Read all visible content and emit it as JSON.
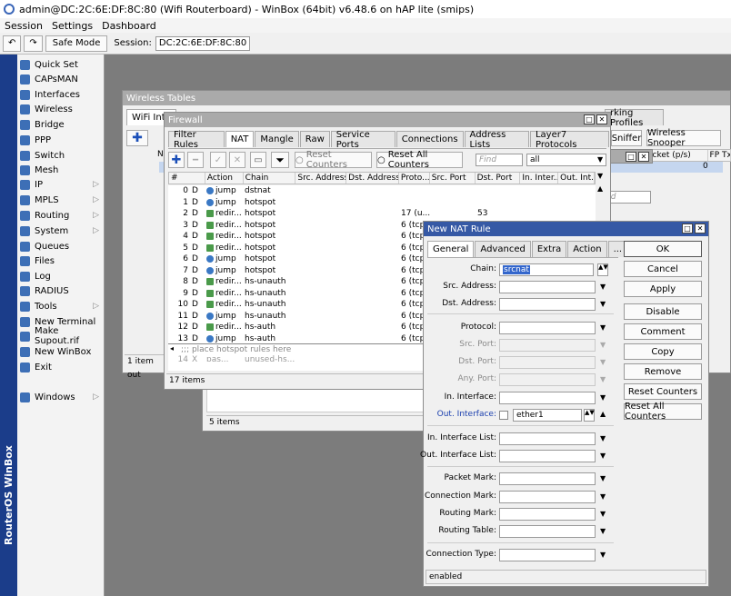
{
  "window_title": "admin@DC:2C:6E:DF:8C:80 (Wifi Routerboard) - WinBox (64bit) v6.48.6 on hAP lite (smips)",
  "menu": [
    "Session",
    "Settings",
    "Dashboard"
  ],
  "toolbar": {
    "safe_mode": "Safe Mode",
    "session_label": "Session:",
    "session_value": "DC:2C:6E:DF:8C:80",
    "undo": "↶",
    "redo": "↷"
  },
  "sidebar_vertical": "RouterOS WinBox",
  "sidebar": [
    {
      "label": "Quick Set",
      "arrow": ""
    },
    {
      "label": "CAPsMAN",
      "arrow": ""
    },
    {
      "label": "Interfaces",
      "arrow": ""
    },
    {
      "label": "Wireless",
      "arrow": ""
    },
    {
      "label": "Bridge",
      "arrow": ""
    },
    {
      "label": "PPP",
      "arrow": ""
    },
    {
      "label": "Switch",
      "arrow": ""
    },
    {
      "label": "Mesh",
      "arrow": ""
    },
    {
      "label": "IP",
      "arrow": "▷"
    },
    {
      "label": "MPLS",
      "arrow": "▷"
    },
    {
      "label": "Routing",
      "arrow": "▷"
    },
    {
      "label": "System",
      "arrow": "▷"
    },
    {
      "label": "Queues",
      "arrow": ""
    },
    {
      "label": "Files",
      "arrow": ""
    },
    {
      "label": "Log",
      "arrow": ""
    },
    {
      "label": "RADIUS",
      "arrow": ""
    },
    {
      "label": "Tools",
      "arrow": "▷"
    },
    {
      "label": "New Terminal",
      "arrow": ""
    },
    {
      "label": "Make Supout.rif",
      "arrow": ""
    },
    {
      "label": "New WinBox",
      "arrow": ""
    },
    {
      "label": "Exit",
      "arrow": ""
    },
    {
      "label": "Windows",
      "arrow": "▷"
    }
  ],
  "wireless": {
    "title": "Wireless Tables",
    "tab_wifi": "WiFi Inte",
    "tab_profiles": "rking Profiles",
    "btn_sniffer": "Sniffer",
    "btn_snooper": "Wireless Snooper",
    "col_packet": "acket (p/s)",
    "col_fp": "FP Tx",
    "val_zero": "0",
    "col_n": "N",
    "find_placeholder": "nd",
    "status": "1 item out"
  },
  "bg_window": {
    "status": "5 items"
  },
  "firewall": {
    "title": "Firewall",
    "tabs": [
      "Filter Rules",
      "NAT",
      "Mangle",
      "Raw",
      "Service Ports",
      "Connections",
      "Address Lists",
      "Layer7 Protocols"
    ],
    "btn_reset": "Reset Counters",
    "btn_reset_all": "Reset All Counters",
    "find_placeholder": "Find",
    "filter_value": "all",
    "columns": [
      "#",
      "Action",
      "Chain",
      "Src. Address",
      "Dst. Address",
      "Proto...",
      "Src. Port",
      "Dst. Port",
      "In. Inter...",
      "Out. Int..."
    ],
    "rows": [
      {
        "num": "0",
        "flag": "D",
        "action": "jump",
        "chain": "dstnat",
        "proto": "",
        "dport": ""
      },
      {
        "num": "1",
        "flag": "D",
        "action": "jump",
        "chain": "hotspot",
        "proto": "",
        "dport": ""
      },
      {
        "num": "2",
        "flag": "D",
        "action": "redir...",
        "chain": "hotspot",
        "proto": "17 (u...",
        "dport": "53"
      },
      {
        "num": "3",
        "flag": "D",
        "action": "redir...",
        "chain": "hotspot",
        "proto": "6 (tcp",
        "dport": ""
      },
      {
        "num": "4",
        "flag": "D",
        "action": "redir...",
        "chain": "hotspot",
        "proto": "6 (tcp",
        "dport": ""
      },
      {
        "num": "5",
        "flag": "D",
        "action": "redir...",
        "chain": "hotspot",
        "proto": "6 (tcp",
        "dport": ""
      },
      {
        "num": "6",
        "flag": "D",
        "action": "jump",
        "chain": "hotspot",
        "proto": "6 (tcp",
        "dport": ""
      },
      {
        "num": "7",
        "flag": "D",
        "action": "jump",
        "chain": "hotspot",
        "proto": "6 (tcp",
        "dport": ""
      },
      {
        "num": "8",
        "flag": "D",
        "action": "redir...",
        "chain": "hs-unauth",
        "proto": "6 (tcp",
        "dport": ""
      },
      {
        "num": "9",
        "flag": "D",
        "action": "redir...",
        "chain": "hs-unauth",
        "proto": "6 (tcp",
        "dport": ""
      },
      {
        "num": "10",
        "flag": "D",
        "action": "redir...",
        "chain": "hs-unauth",
        "proto": "6 (tcp",
        "dport": ""
      },
      {
        "num": "11",
        "flag": "D",
        "action": "jump",
        "chain": "hs-unauth",
        "proto": "6 (tcp",
        "dport": ""
      },
      {
        "num": "12",
        "flag": "D",
        "action": "redir...",
        "chain": "hs-auth",
        "proto": "6 (tcp",
        "dport": ""
      },
      {
        "num": "13",
        "flag": "D",
        "action": "jump",
        "chain": "hs-auth",
        "proto": "6 (tcp",
        "dport": ""
      }
    ],
    "comment_row": ";;; place hotspot rules here",
    "partial_row": {
      "num": "14",
      "flag": "X",
      "action": "pas...",
      "chain": "unused-hs..."
    },
    "status": "17 items"
  },
  "nat_rule": {
    "title": "New NAT Rule",
    "tabs": [
      "General",
      "Advanced",
      "Extra",
      "Action",
      "..."
    ],
    "fields": {
      "chain": {
        "label": "Chain:",
        "value": "srcnat"
      },
      "src_address": {
        "label": "Src. Address:",
        "value": ""
      },
      "dst_address": {
        "label": "Dst. Address:",
        "value": ""
      },
      "protocol": {
        "label": "Protocol:",
        "value": ""
      },
      "src_port": {
        "label": "Src. Port:",
        "value": ""
      },
      "dst_port": {
        "label": "Dst. Port:",
        "value": ""
      },
      "any_port": {
        "label": "Any. Port:",
        "value": ""
      },
      "in_interface": {
        "label": "In. Interface:",
        "value": ""
      },
      "out_interface": {
        "label": "Out. Interface:",
        "value": "ether1"
      },
      "in_interface_list": {
        "label": "In. Interface List:",
        "value": ""
      },
      "out_interface_list": {
        "label": "Out. Interface List:",
        "value": ""
      },
      "packet_mark": {
        "label": "Packet Mark:",
        "value": ""
      },
      "connection_mark": {
        "label": "Connection Mark:",
        "value": ""
      },
      "routing_mark": {
        "label": "Routing Mark:",
        "value": ""
      },
      "routing_table": {
        "label": "Routing Table:",
        "value": ""
      },
      "connection_type": {
        "label": "Connection Type:",
        "value": ""
      }
    },
    "buttons": [
      "OK",
      "Cancel",
      "Apply",
      "Disable",
      "Comment",
      "Copy",
      "Remove",
      "Reset Counters",
      "Reset All Counters"
    ],
    "status": "enabled"
  }
}
